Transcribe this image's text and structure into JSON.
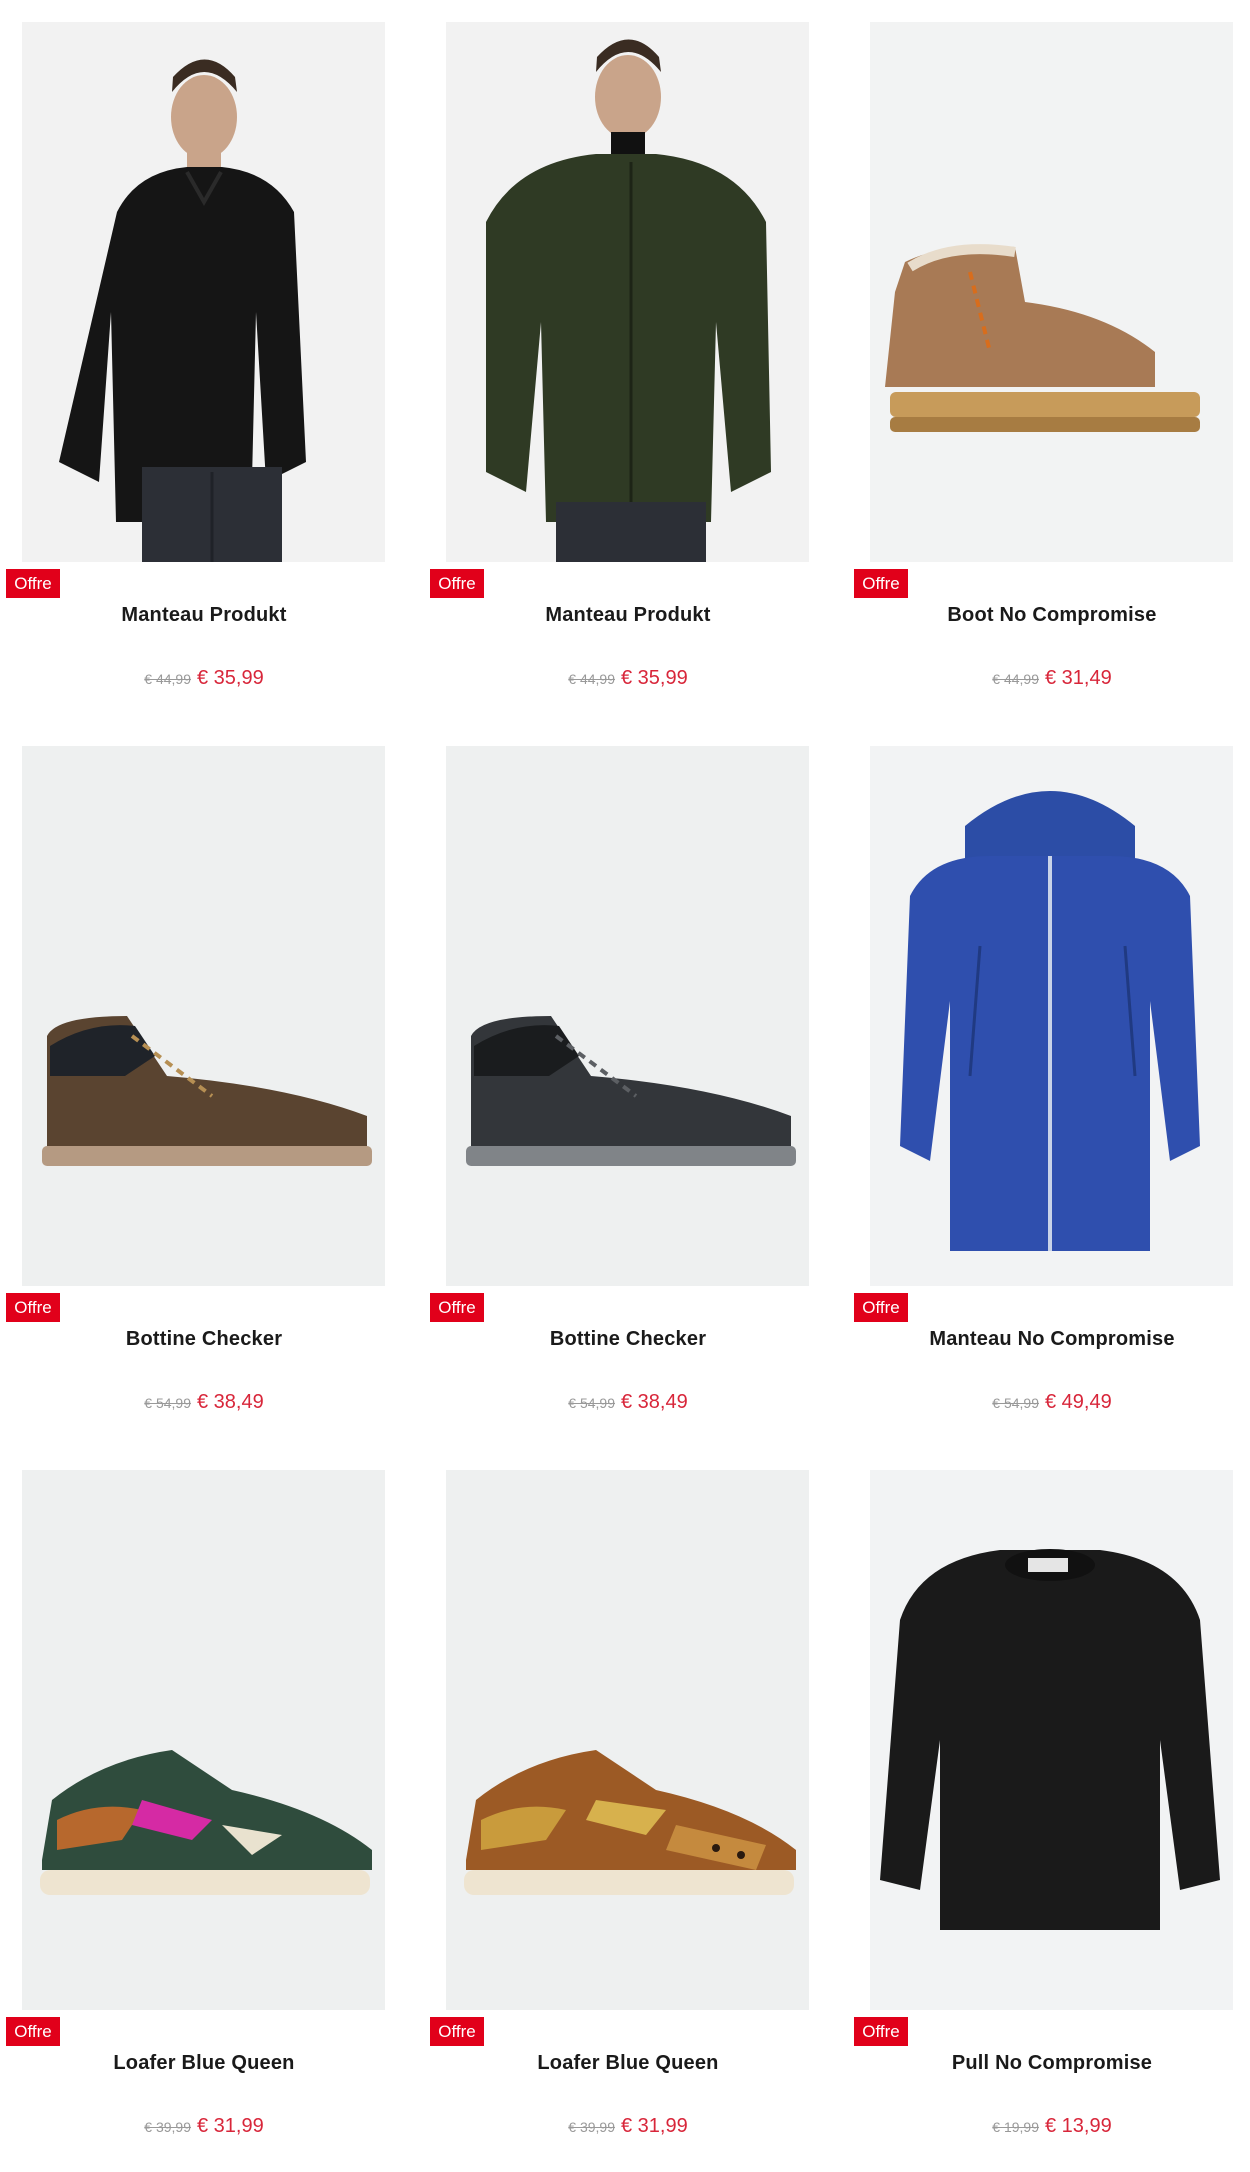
{
  "products": [
    {
      "badge": "Offre",
      "title": "Manteau Produkt",
      "old_price": "€ 44,99",
      "new_price": "€ 35,99",
      "image": "man-black-fleece-jacket"
    },
    {
      "badge": "Offre",
      "title": "Manteau Produkt",
      "old_price": "€ 44,99",
      "new_price": "€ 35,99",
      "image": "man-green-fleece-jacket"
    },
    {
      "badge": "Offre",
      "title": "Boot No Compromise",
      "old_price": "€ 44,99",
      "new_price": "€ 31,49",
      "image": "tan-lace-up-boot"
    },
    {
      "badge": "Offre",
      "title": "Bottine Checker",
      "old_price": "€ 54,99",
      "new_price": "€ 38,49",
      "image": "brown-high-top-sneaker"
    },
    {
      "badge": "Offre",
      "title": "Bottine Checker",
      "old_price": "€ 54,99",
      "new_price": "€ 38,49",
      "image": "dark-grey-high-top-sneaker"
    },
    {
      "badge": "Offre",
      "title": "Manteau No Compromise",
      "old_price": "€ 54,99",
      "new_price": "€ 49,49",
      "image": "blue-hooded-jacket"
    },
    {
      "badge": "Offre",
      "title": "Loafer Blue Queen",
      "old_price": "€ 39,99",
      "new_price": "€ 31,99",
      "image": "green-pink-sneaker"
    },
    {
      "badge": "Offre",
      "title": "Loafer Blue Queen",
      "old_price": "€ 39,99",
      "new_price": "€ 31,99",
      "image": "gold-leopard-sneaker"
    },
    {
      "badge": "Offre",
      "title": "Pull No Compromise",
      "old_price": "€ 19,99",
      "new_price": "€ 13,99",
      "image": "black-sweater"
    }
  ],
  "colors": {
    "badge": "#e1001a",
    "sale_price": "#d8263a",
    "old_price": "#999999",
    "image_bg": "#eef0f0"
  }
}
